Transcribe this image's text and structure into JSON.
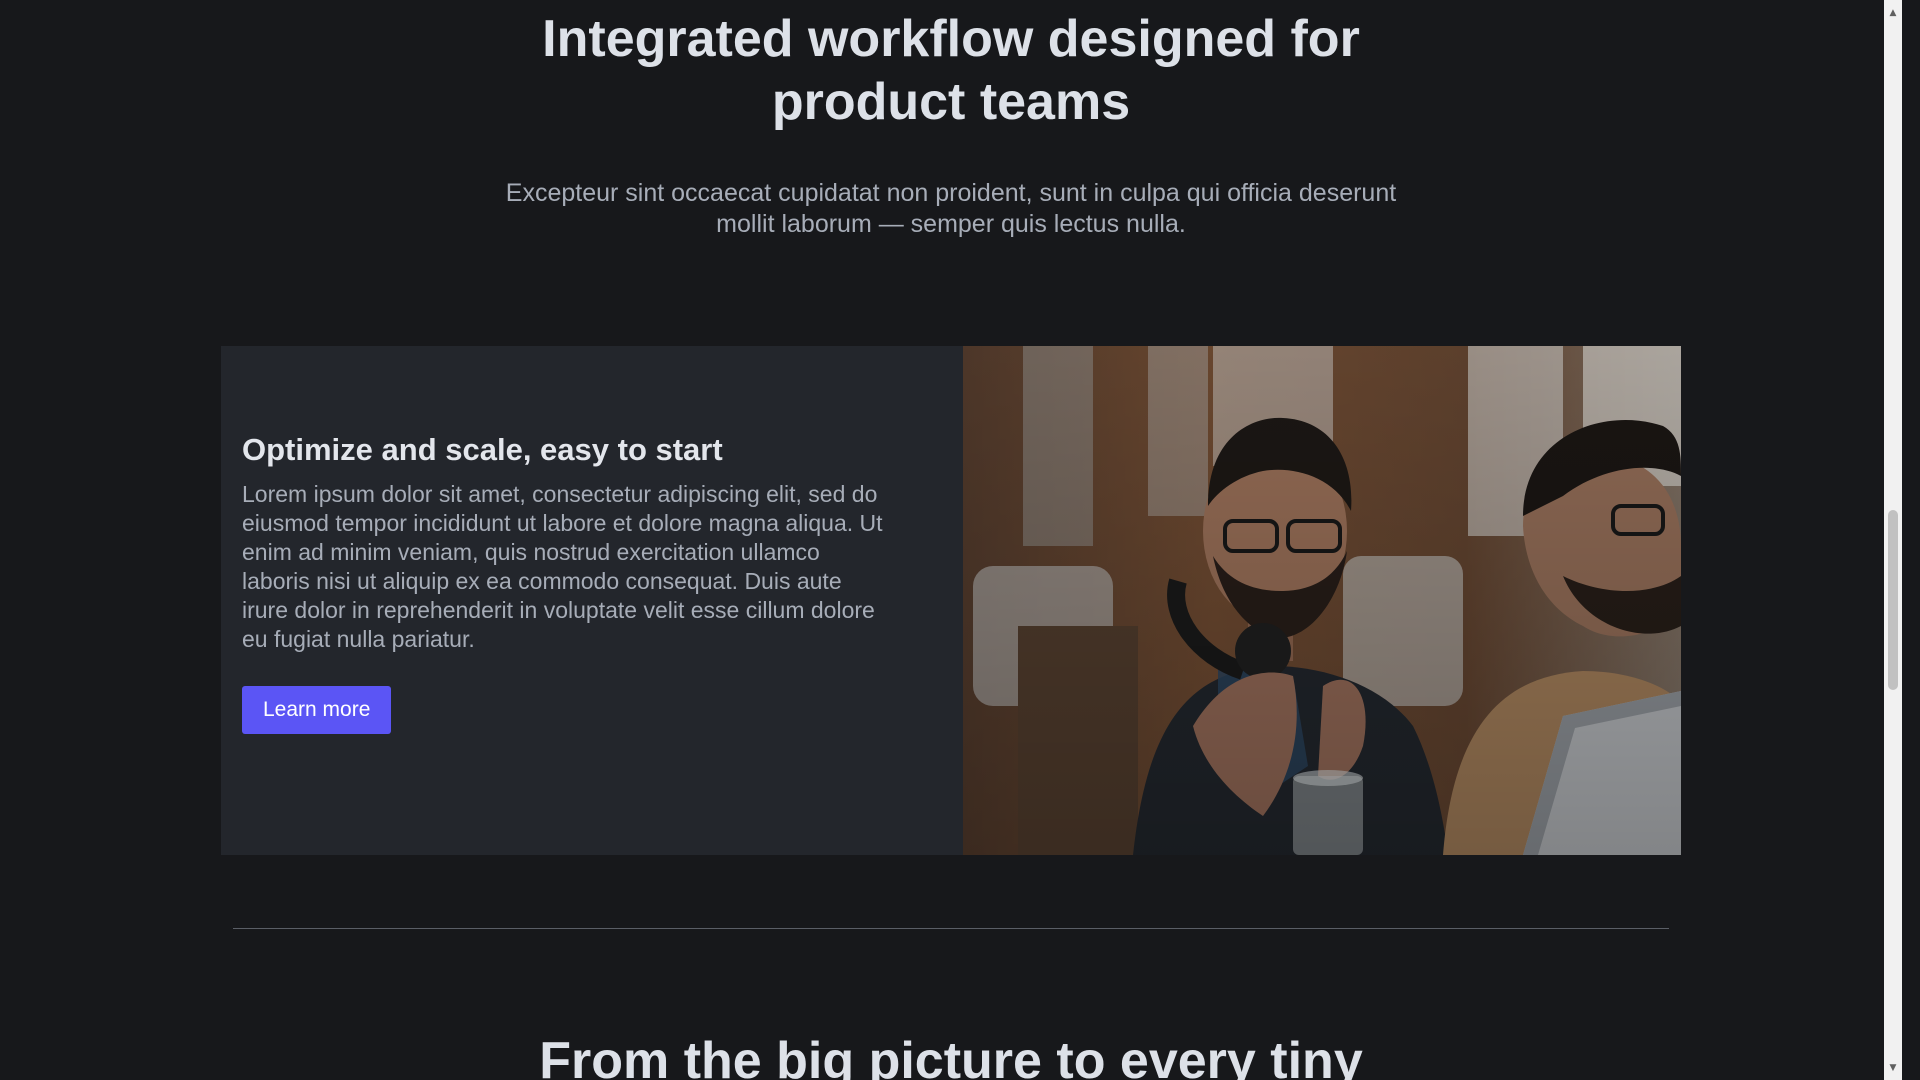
{
  "hero": {
    "title_line1": "Integrated workflow designed for",
    "title_line2": "product teams",
    "subtitle_line1": "Excepteur sint occaecat cupidatat non proident, sunt in culpa qui officia deserunt",
    "subtitle_line2": "mollit laborum — semper quis lectus nulla."
  },
  "feature": {
    "title": "Optimize and scale, easy to start",
    "body": "Lorem ipsum dolor sit amet, consectetur adipiscing elit, sed do eiusmod tempor incididunt ut labore et dolore magna aliqua. Ut enim ad minim veniam, quis nostrud exercitation ullamco laboris nisi ut aliquip ex ea commodo consequat. Duis aute irure dolor in reprehenderit in voluptate velit esse cillum dolore eu fugiat nulla pariatur.",
    "button_label": "Learn more",
    "image": "photo-two-men-at-laptops"
  },
  "next_section": {
    "title": "From the big picture to every tiny"
  },
  "colors": {
    "background": "#17181b",
    "card": "#23262c",
    "accent": "#5b55f5",
    "heading": "#dde1e8",
    "muted_text": "#a7adb8"
  },
  "scrollbar": {
    "up_icon": "arrow-up-icon",
    "down_icon": "arrow-down-icon"
  }
}
